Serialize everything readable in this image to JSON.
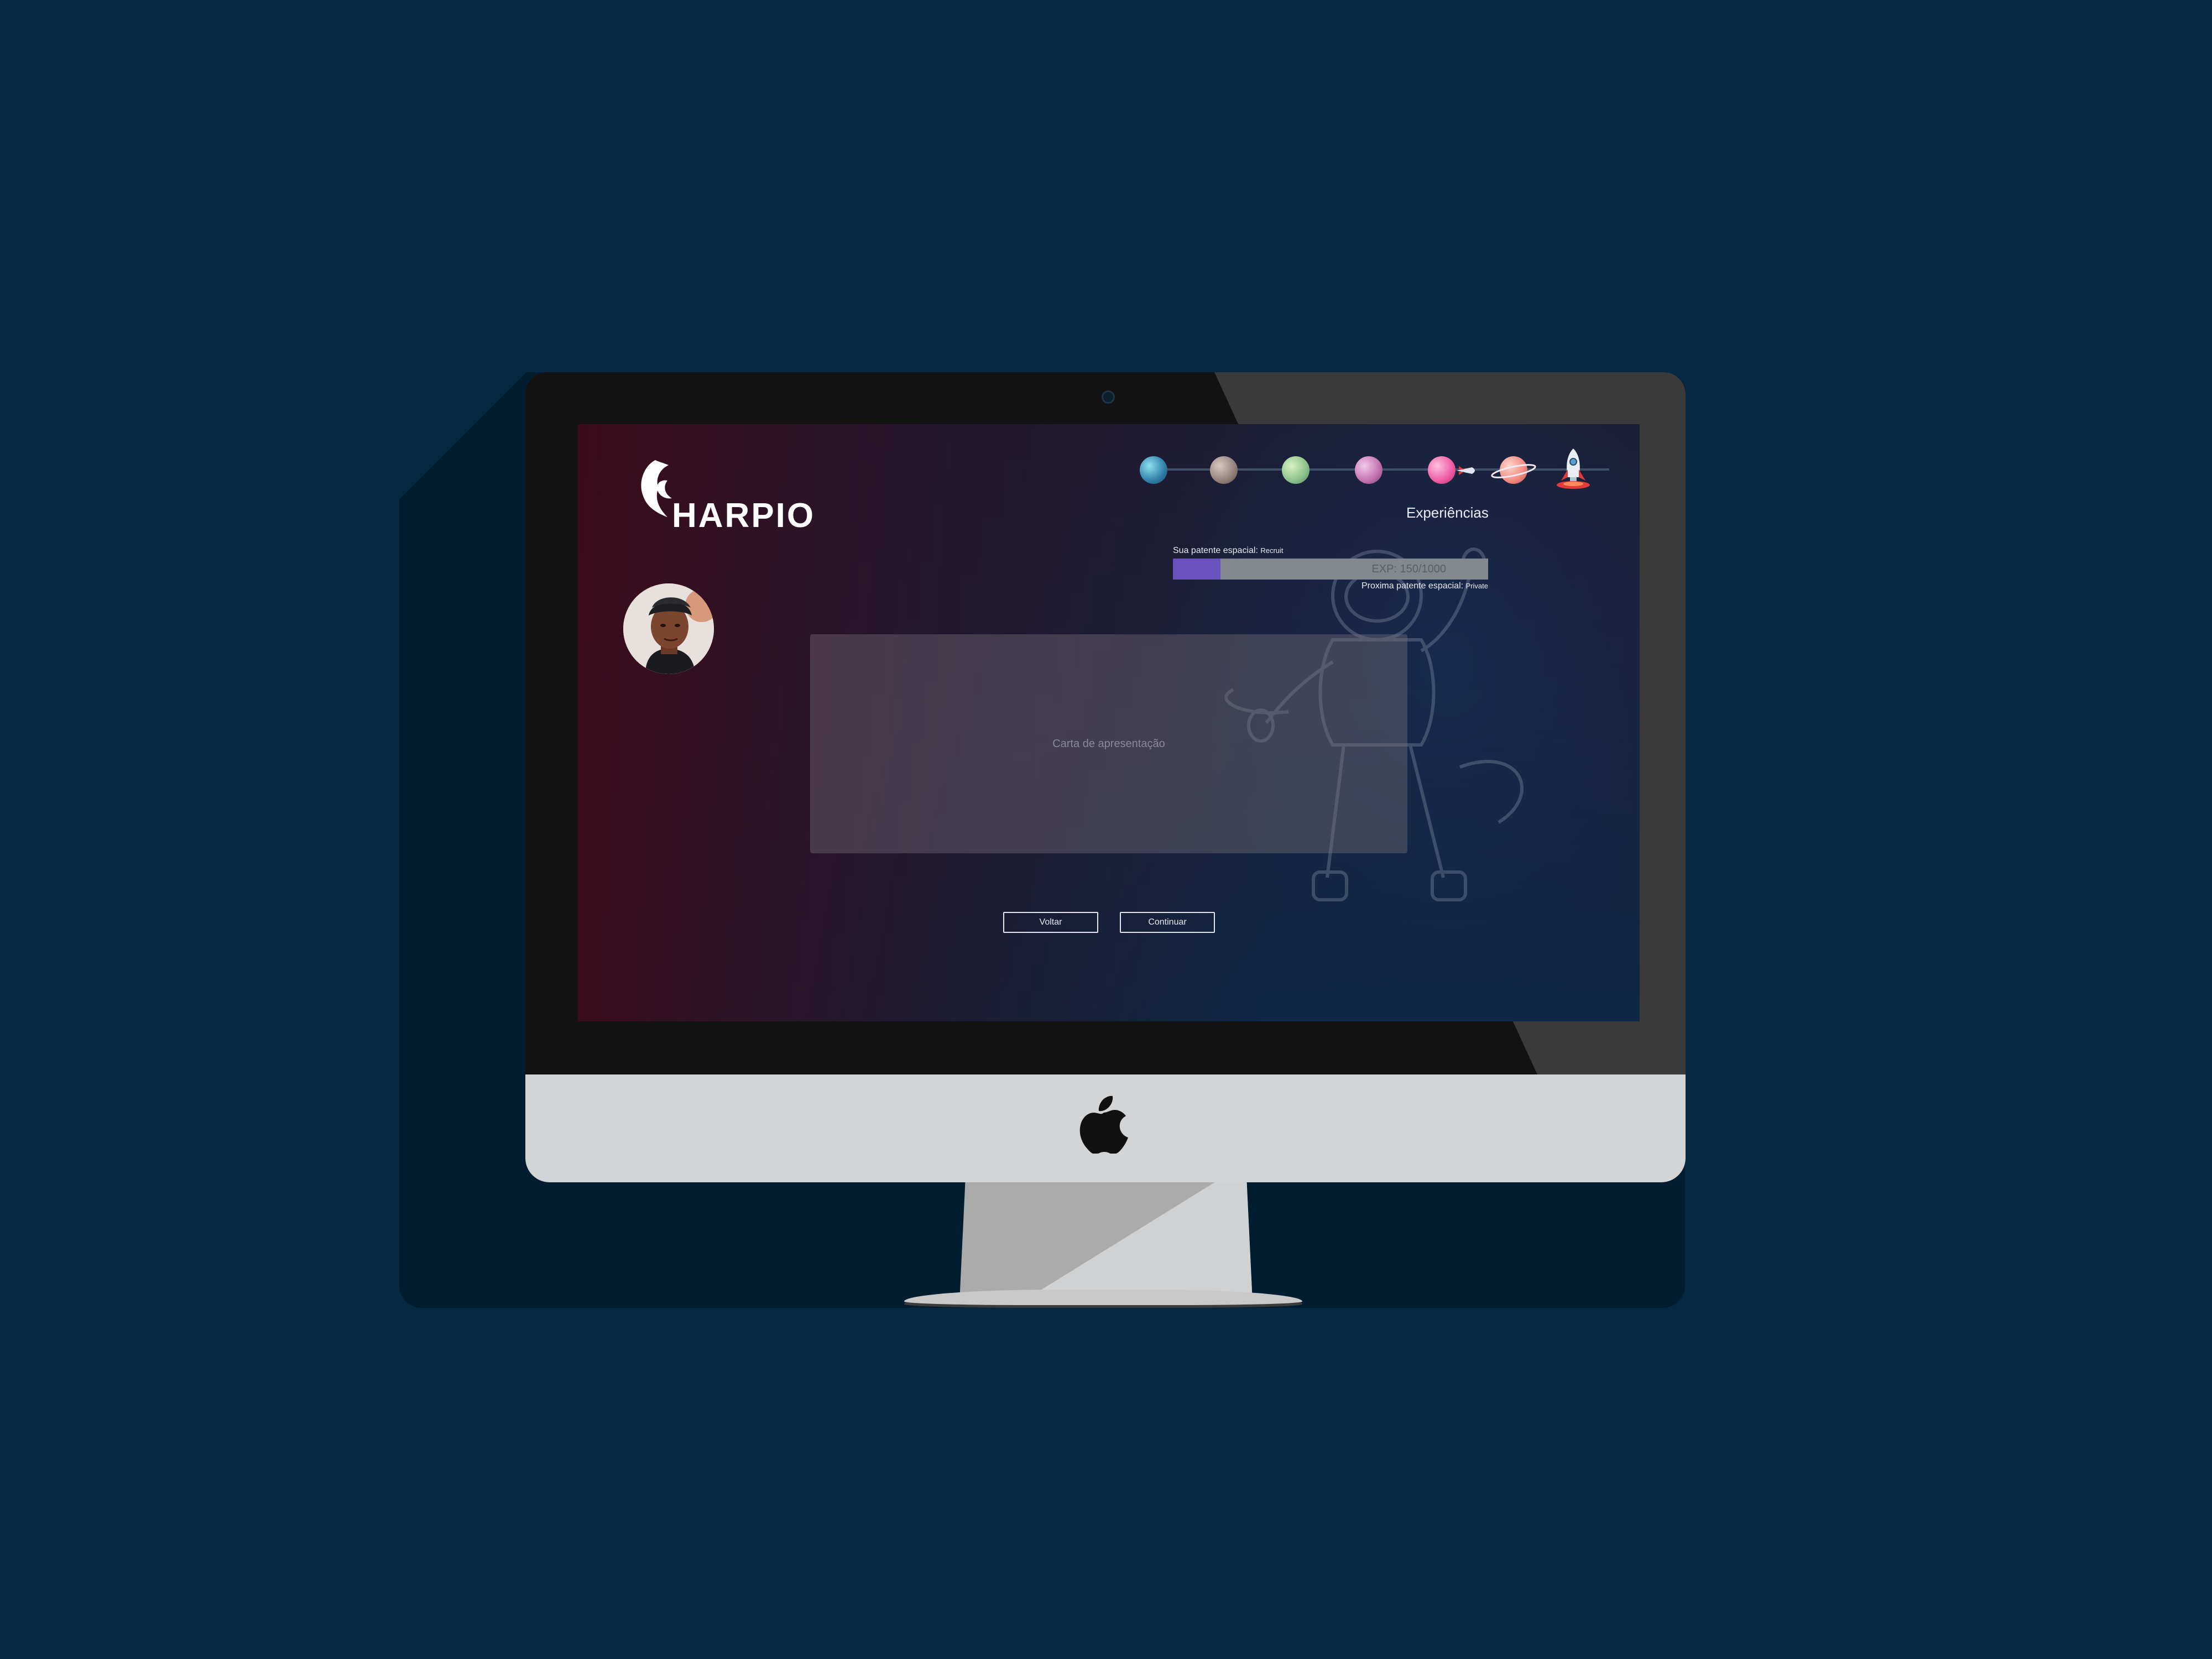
{
  "app": {
    "logo_text": "HARPIO"
  },
  "progress": {
    "stages": [
      "earth-icon",
      "moon-icon",
      "green-planet-icon",
      "pink-planet-icon",
      "pink-planet-rocket-icon",
      "ringed-planet-icon",
      "rocket-launch-icon"
    ],
    "label": "Experiências"
  },
  "rank": {
    "current_label": "Sua patente espacial:",
    "current_value": "Recruit",
    "exp_text": "EXP: 150/1000",
    "exp_current": 150,
    "exp_max": 1000,
    "next_label": "Proxima patente espacial:",
    "next_value": "Private"
  },
  "main": {
    "cover_letter_placeholder": "Carta de apresentação"
  },
  "actions": {
    "back_label": "Voltar",
    "continue_label": "Continuar"
  },
  "colors": {
    "page_background": "#062841",
    "exp_fill": "#6a52bf",
    "exp_track": "#83888f"
  }
}
